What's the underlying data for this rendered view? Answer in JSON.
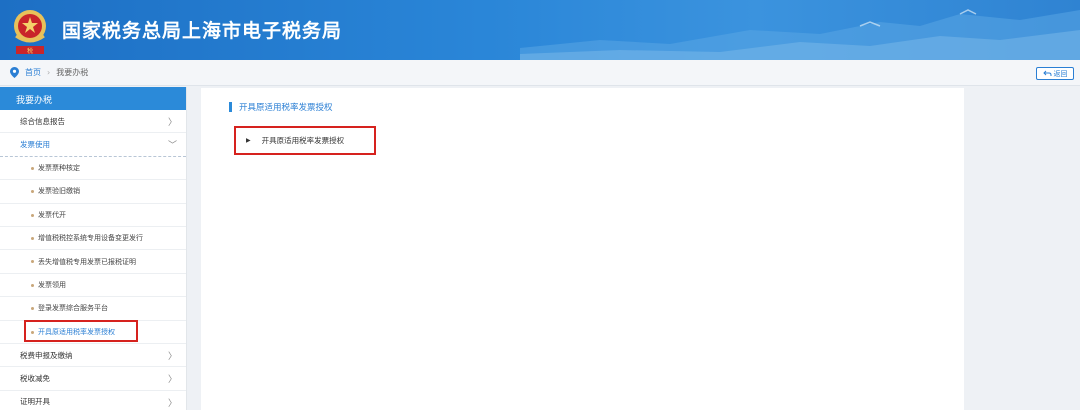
{
  "header": {
    "title": "国家税务总局上海市电子税务局",
    "emblem_icon": "national-tax-emblem",
    "brand_color": "#2a86d8"
  },
  "breadcrumb": {
    "home": "首页",
    "separator": "›",
    "current": "我要办税",
    "back_label": "返回"
  },
  "sidebar": {
    "heading": "我要办税",
    "items": [
      {
        "label": "综合信息报告",
        "arrow": "〉"
      },
      {
        "label": "发票使用",
        "arrow": "﹀"
      }
    ],
    "sub_items": [
      {
        "label": "发票票种核定"
      },
      {
        "label": "发票验旧缴销"
      },
      {
        "label": "发票代开"
      },
      {
        "label": "增值税税控系统专用设备变更发行"
      },
      {
        "label": "丢失增值税专用发票已报税证明"
      },
      {
        "label": "发票领用"
      },
      {
        "label": "登录发票综合服务平台"
      },
      {
        "label": "开具原适用税率发票授权"
      }
    ],
    "bottom_items": [
      {
        "label": "税费申报及缴纳",
        "arrow": "〉"
      },
      {
        "label": "税收减免",
        "arrow": "〉"
      },
      {
        "label": "证明开具",
        "arrow": "〉"
      }
    ]
  },
  "main": {
    "section_title": "开具原适用税率发票授权",
    "item_label": "开具原适用税率发票授权",
    "item_marker": "▶"
  },
  "highlight_color": "#d6221e"
}
